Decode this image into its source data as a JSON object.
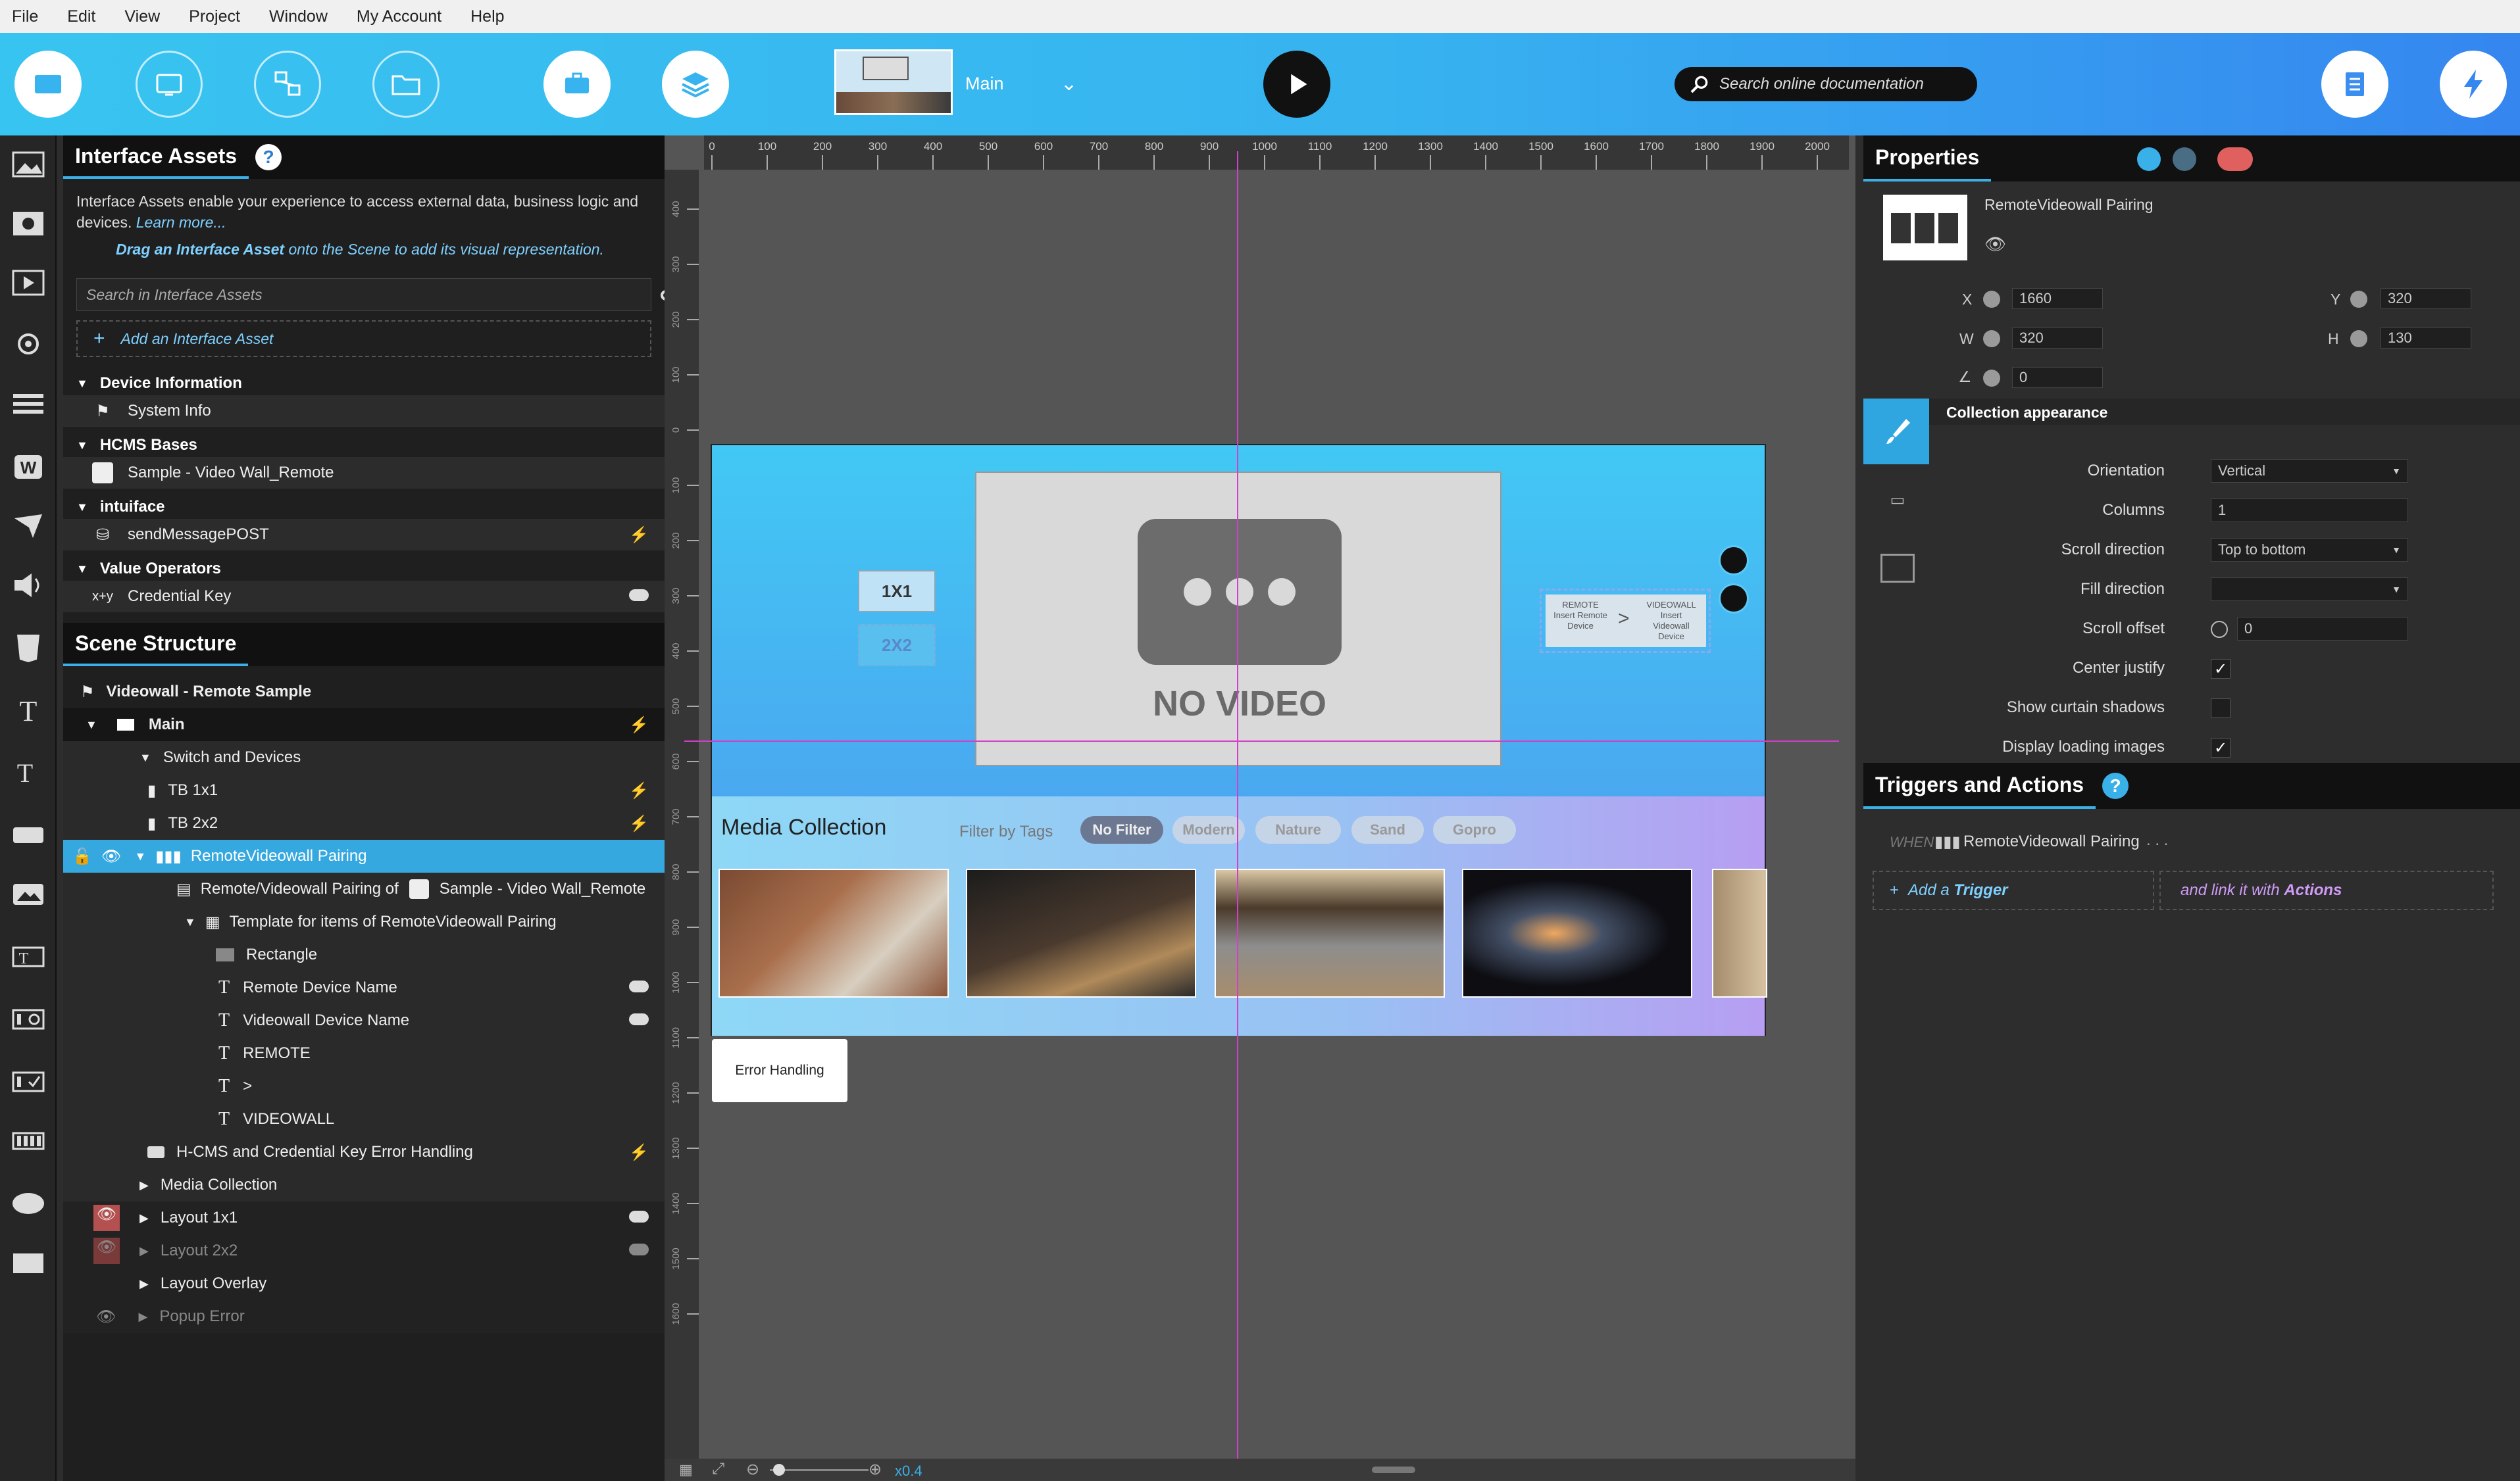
{
  "menu": [
    "File",
    "Edit",
    "View",
    "Project",
    "Window",
    "My Account",
    "Help"
  ],
  "toolbar": {
    "scene_label": "Main",
    "search_placeholder": "Search online documentation"
  },
  "interface_assets": {
    "title": "Interface Assets",
    "help": "?",
    "desc_line1": "Interface Assets enable your experience to access external data, business logic and",
    "desc_line2": "devices.",
    "learn_more": "Learn more...",
    "drag_bold": "Drag an Interface Asset",
    "drag_rest": "onto the Scene to add its visual representation.",
    "search_placeholder": "Search in Interface Assets",
    "add_label": "Add an Interface Asset",
    "sections": [
      {
        "title": "Device Information",
        "item": "System Info"
      },
      {
        "title": "HCMS Bases",
        "item": "Sample - Video Wall_Remote"
      },
      {
        "title": "intuiface",
        "item": "sendMessagePOST"
      },
      {
        "title": "Value Operators",
        "item": "Credential Key"
      }
    ]
  },
  "scene_structure": {
    "title": "Scene Structure",
    "root": "Videowall - Remote Sample",
    "items": [
      "Main",
      "Switch and Devices",
      "TB 1x1",
      "TB 2x2",
      "RemoteVideowall Pairing",
      "Remote/Videowall Pairing of",
      "Sample - Video Wall_Remote",
      "Template for items of RemoteVideowall Pairing",
      "Rectangle",
      "Remote Device Name",
      "Videowall Device Name",
      "REMOTE",
      ">",
      "VIDEOWALL",
      "H-CMS and Credential Key Error Handling",
      "Media Collection",
      "Layout 1x1",
      "Layout 2x2",
      "Layout Overlay",
      "Popup Error"
    ]
  },
  "ruler_x": [
    "0",
    "100",
    "200",
    "300",
    "400",
    "500",
    "600",
    "700",
    "800",
    "900",
    "1000",
    "1100",
    "1200",
    "1300",
    "1400",
    "1500",
    "1600",
    "1700",
    "1800",
    "1900",
    "2000"
  ],
  "ruler_y": [
    "400",
    "300",
    "200",
    "100",
    "0",
    "100",
    "200",
    "300",
    "400",
    "500",
    "600",
    "700",
    "800",
    "900",
    "1000",
    "1100",
    "1200",
    "1300",
    "1400",
    "1500",
    "1600"
  ],
  "canvas": {
    "no_video": "NO VIDEO",
    "btn_1x1": "1X1",
    "btn_2x2": "2X2",
    "remote_left": "REMOTE Insert Remote Device",
    "remote_right": "VIDEOWALL Insert Videowall Device",
    "media_title": "Media Collection",
    "filter_label": "Filter by Tags",
    "tags": [
      "No Filter",
      "Modern",
      "Nature",
      "Sand",
      "Gopro"
    ],
    "error_handling": "Error Handling",
    "zoom": "x0.4"
  },
  "properties": {
    "title": "Properties",
    "element_name": "RemoteVideowall Pairing",
    "x_label": "X",
    "x": "1660",
    "y_label": "Y",
    "y": "320",
    "w_label": "W",
    "w": "320",
    "h_label": "H",
    "h": "130",
    "angle": "0",
    "collection_header": "Collection appearance",
    "rows": [
      {
        "label": "Orientation",
        "value": "Vertical"
      },
      {
        "label": "Columns",
        "value": "1"
      },
      {
        "label": "Scroll direction",
        "value": "Top to bottom"
      },
      {
        "label": "Fill direction",
        "value": ""
      },
      {
        "label": "Scroll offset",
        "value": "0"
      },
      {
        "label": "Center justify",
        "checked": true
      },
      {
        "label": "Show curtain shadows",
        "checked": false
      },
      {
        "label": "Display loading images",
        "checked": true
      }
    ]
  },
  "triggers": {
    "title": "Triggers and Actions",
    "help": "?",
    "when": "WHEN",
    "when_target": "RemoteVideowall Pairing",
    "dots": ". . .",
    "add_trigger": "Add a",
    "trigger_word": "Trigger",
    "link": "and link it with",
    "actions_word": "Actions"
  }
}
